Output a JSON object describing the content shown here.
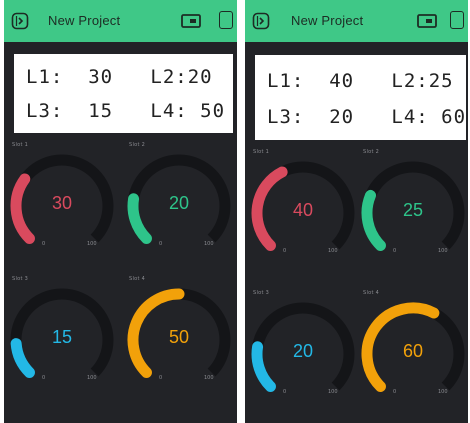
{
  "screens": [
    {
      "title": "New Project",
      "lcd": {
        "line1": "L1:  30   L2:20",
        "line2": "L3:  15   L4: 50"
      },
      "gauges": [
        {
          "label": "Slot 1",
          "value": "30",
          "min": "0",
          "max": "100",
          "level": 0.3,
          "color": "#d94a5e"
        },
        {
          "label": "Slot 2",
          "value": "20",
          "min": "0",
          "max": "100",
          "level": 0.2,
          "color": "#2ec48a"
        },
        {
          "label": "Slot 3",
          "value": "15",
          "min": "0",
          "max": "100",
          "level": 0.15,
          "color": "#23b8e6"
        },
        {
          "label": "Slot 4",
          "value": "50",
          "min": "0",
          "max": "100",
          "level": 0.5,
          "color": "#f2a10a"
        }
      ]
    },
    {
      "title": "New Project",
      "lcd": {
        "line1": "L1:  40   L2:25",
        "line2": "L3:  20   L4: 60"
      },
      "gauges": [
        {
          "label": "Slot 1",
          "value": "40",
          "min": "0",
          "max": "100",
          "level": 0.4,
          "color": "#d94a5e"
        },
        {
          "label": "Slot 2",
          "value": "25",
          "min": "0",
          "max": "100",
          "level": 0.25,
          "color": "#2ec48a"
        },
        {
          "label": "Slot 3",
          "value": "20",
          "min": "0",
          "max": "100",
          "level": 0.2,
          "color": "#23b8e6"
        },
        {
          "label": "Slot 4",
          "value": "60",
          "min": "0",
          "max": "100",
          "level": 0.6,
          "color": "#f2a10a"
        }
      ]
    }
  ],
  "colors": {
    "topbar": "#3fc887",
    "background": "#222327",
    "track": "#141518"
  },
  "icons": [
    "back-icon",
    "device-icon",
    "square-icon"
  ]
}
